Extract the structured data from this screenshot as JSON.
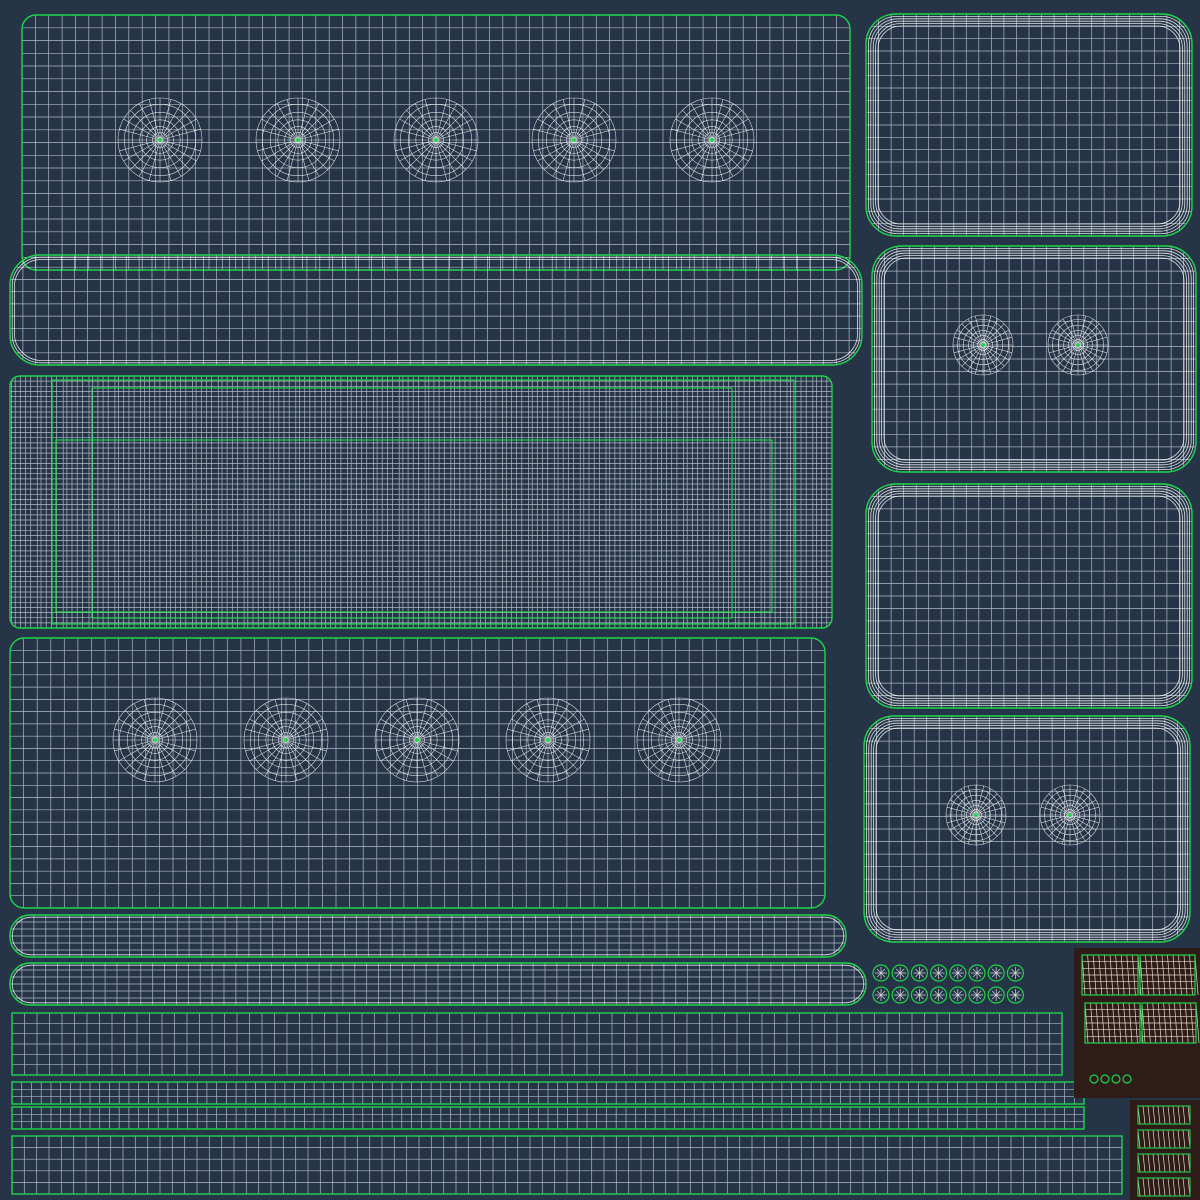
{
  "view": {
    "background_color": "#253447",
    "wire_color": "#dfe6ee",
    "wire_opacity": 0.75,
    "border_color": "#1ed64a",
    "dark_patch_color": "#2e1c18"
  },
  "islands": [
    {
      "name": "uv-island-sofa-back",
      "pinches": 5
    },
    {
      "name": "uv-island-sofa-back-roll",
      "pinches": 0
    },
    {
      "name": "uv-island-sofa-frame",
      "pinches": 0
    },
    {
      "name": "uv-island-sofa-seat",
      "pinches": 5
    },
    {
      "name": "uv-island-cushion-top-1",
      "pinches": 0
    },
    {
      "name": "uv-island-cushion-top-2",
      "pinches": 2
    },
    {
      "name": "uv-island-cushion-top-3",
      "pinches": 0
    },
    {
      "name": "uv-island-cushion-top-4",
      "pinches": 2
    },
    {
      "name": "uv-island-piping-1",
      "pinches": 0
    },
    {
      "name": "uv-island-piping-2",
      "pinches": 0
    },
    {
      "name": "uv-island-strip-1",
      "pinches": 0
    },
    {
      "name": "uv-island-strip-2",
      "pinches": 0
    },
    {
      "name": "uv-island-strip-3",
      "pinches": 0
    },
    {
      "name": "uv-island-strip-4",
      "pinches": 0
    },
    {
      "name": "uv-island-buttons",
      "pinches": 0
    },
    {
      "name": "uv-island-legs-patch",
      "pinches": 0
    },
    {
      "name": "uv-island-feet-column",
      "pinches": 0
    }
  ]
}
